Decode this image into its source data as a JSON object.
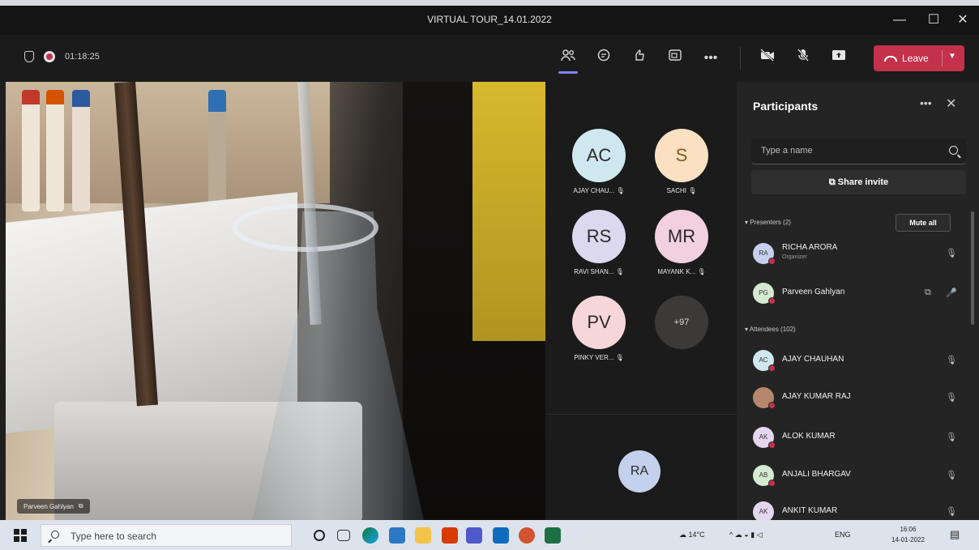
{
  "window": {
    "title": "VIRTUAL TOUR_14.01.2022",
    "minimize": "—",
    "maximize": "☐",
    "close": "✕"
  },
  "meeting": {
    "timer": "01:18:25",
    "leave_label": "Leave",
    "toolbar_icons": [
      "people-icon",
      "chat-icon",
      "reactions-icon",
      "rooms-icon",
      "more-icon",
      "camera-off-icon",
      "mic-off-icon",
      "share-icon"
    ]
  },
  "video": {
    "presenter_name": "Parveen Gahlyan"
  },
  "gallery": {
    "tiles": [
      {
        "initials": "AC",
        "name": "AJAY CHAU...",
        "color": "#cfe8f0"
      },
      {
        "initials": "S",
        "name": "SACHI",
        "color": "#fbe1c1"
      },
      {
        "initials": "RS",
        "name": "RAVI SHAN...",
        "color": "#dcd8ee"
      },
      {
        "initials": "MR",
        "name": "MAYANK K...",
        "color": "#f2d0df"
      },
      {
        "initials": "PV",
        "name": "PINKY VER...",
        "color": "#f6d6d8"
      }
    ],
    "overflow_count": "+97",
    "me_initials": "RA"
  },
  "participants": {
    "title": "Participants",
    "search_placeholder": "Type a name",
    "share_invite_label": "Share invite",
    "presenters_heading": "Presenters (2)",
    "mute_all_label": "Mute all",
    "attendees_heading": "Attendees (102)",
    "presenters": [
      {
        "initials": "RA",
        "name": "RICHA ARORA",
        "role": "Organizer",
        "color": "#c4d0ec"
      },
      {
        "initials": "PG",
        "name": "Parveen Gahlyan",
        "role": "",
        "color": "#d3ead0"
      }
    ],
    "attendees": [
      {
        "initials": "AC",
        "name": "AJAY CHAUHAN",
        "color": "#cfe8f0"
      },
      {
        "initials": "",
        "name": "AJAY KUMAR RAJ",
        "color": "#b6876c"
      },
      {
        "initials": "AK",
        "name": "ALOK KUMAR",
        "color": "#e3d6ee"
      },
      {
        "initials": "AB",
        "name": "ANJALI BHARGAV",
        "color": "#d3ead0"
      },
      {
        "initials": "AK",
        "name": "ANKIT KUMAR",
        "color": "#e3d6ee"
      }
    ]
  },
  "taskbar": {
    "search_placeholder": "Type here to search",
    "weather": "14°C",
    "language": "ENG",
    "time": "16:06",
    "date": "14-01-2022"
  }
}
